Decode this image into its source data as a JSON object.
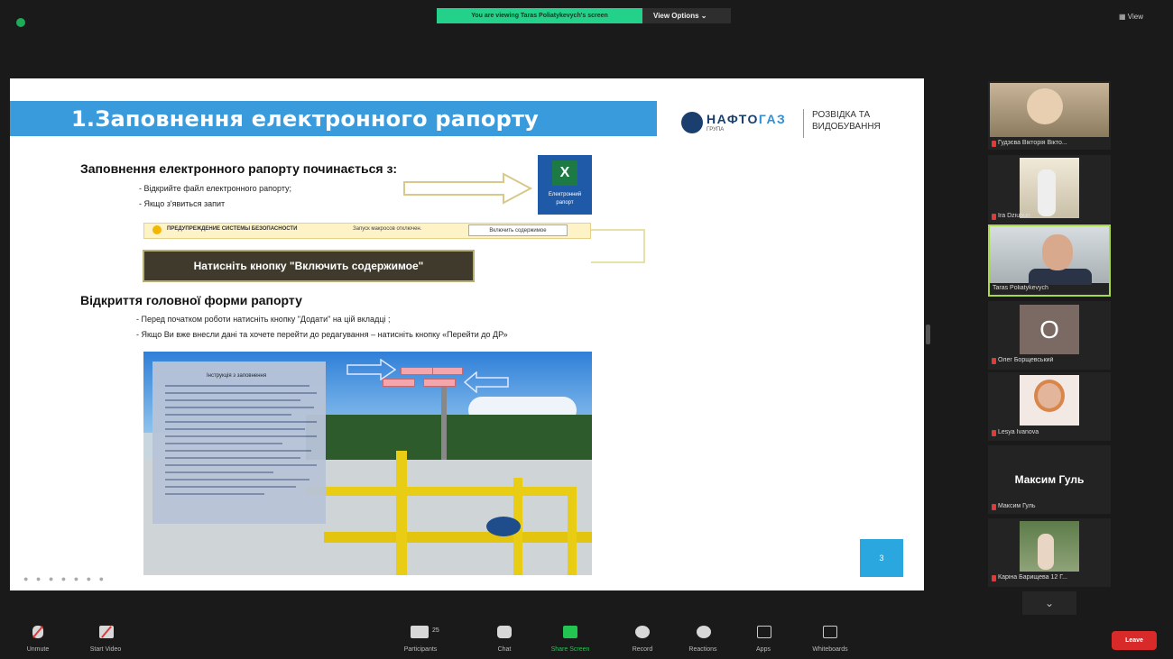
{
  "meeting": {
    "banner": "You are viewing Taras Poliatykevych's screen",
    "view_options": "View Options ⌄",
    "view_btn": "View"
  },
  "slide": {
    "title": "1.Заповнення електронного рапорту",
    "logo": {
      "name_part1": "НАФТО",
      "name_part2": "ГАЗ",
      "sub": "ГРУПА",
      "division_line1": "РОЗВІДКА ТА",
      "division_line2": "ВИДОБУВАННЯ"
    },
    "section1": {
      "heading": "Заповнення електронного рапорту починається з:",
      "bullets": [
        "- Відкрийте файл електронного рапорту;",
        "- Якщо з'явиться запит"
      ]
    },
    "excel_icon_label": "Електронний рапорт",
    "security_warning": {
      "title": "ПРЕДУПРЕЖДЕНИЕ СИСТЕМЫ БЕЗОПАСНОСТИ",
      "message": "Запуск макросов отключен.",
      "button": "Включить содержимое"
    },
    "action_button": "Натисніть кнопку \"Включить содержимое\"",
    "section2": {
      "heading": "Відкриття головної форми рапорту",
      "bullets": [
        "- Перед початком роботи натисніть кнопку \"Додати\" на цій вкладці ;",
        "- Якщо Ви вже внесли дані та хочете перейти до редагування – натисніть кнопку «Перейти до ДР»"
      ]
    },
    "form_title": "Інструкція з заповнення",
    "page_number": "3"
  },
  "participants": [
    {
      "name": "Гудзєва Вікторія Вікто..."
    },
    {
      "name": "Ira Dziubun"
    },
    {
      "name": "Taras Poliatykevych"
    },
    {
      "name": "Олег Борщевський",
      "initial": "O"
    },
    {
      "name": "Lesya Ivanova"
    },
    {
      "name": "Максим Гуль",
      "display": "Максим Гуль"
    },
    {
      "name": "Каріна Барищева 12 Г..."
    }
  ],
  "toolbar": {
    "unmute": "Unmute",
    "start_video": "Start Video",
    "participants": "Participants",
    "participants_count": "25",
    "chat": "Chat",
    "share_screen": "Share Screen",
    "record": "Record",
    "reactions": "Reactions",
    "apps": "Apps",
    "whiteboards": "Whiteboards",
    "leave": "Leave"
  },
  "colors": {
    "share_green": "#23c552",
    "leave_red": "#d92a2a",
    "slide_title_blue": "#3a9bdc",
    "active_speaker_border": "#a9d84a"
  }
}
